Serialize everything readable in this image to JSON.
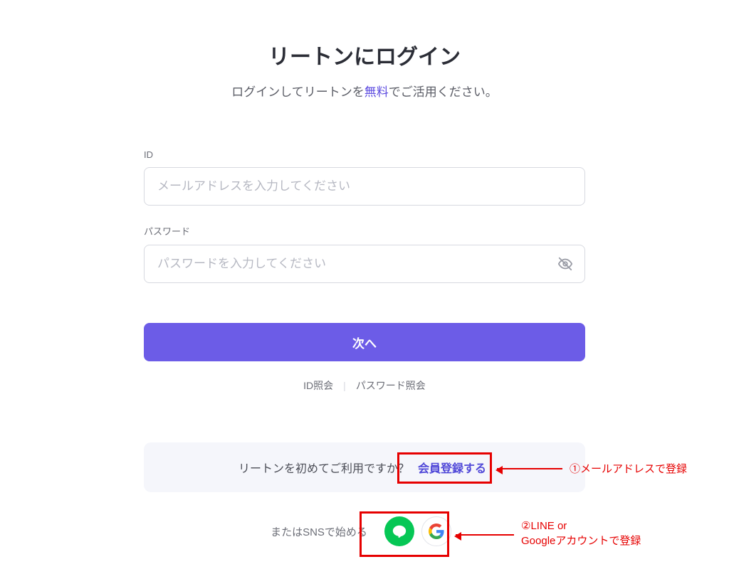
{
  "title": "リートンにログイン",
  "subtitle_pre": "ログインしてリートンを",
  "subtitle_accent": "無料",
  "subtitle_post": "でご活用ください。",
  "id_label": "ID",
  "id_placeholder": "メールアドレスを入力してください",
  "password_label": "パスワード",
  "password_placeholder": "パスワードを入力してください",
  "next_button": "次へ",
  "id_lookup": "ID照会",
  "password_lookup": "パスワード照会",
  "signup_prompt": "リートンを初めてご利用ですか？",
  "signup_link": "会員登録する",
  "sns_label": "またはSNSで始める",
  "annotations": {
    "a1": "①メールアドレスで登録",
    "a2_line1": "②LINE or",
    "a2_line2": "Googleアカウントで登録"
  }
}
